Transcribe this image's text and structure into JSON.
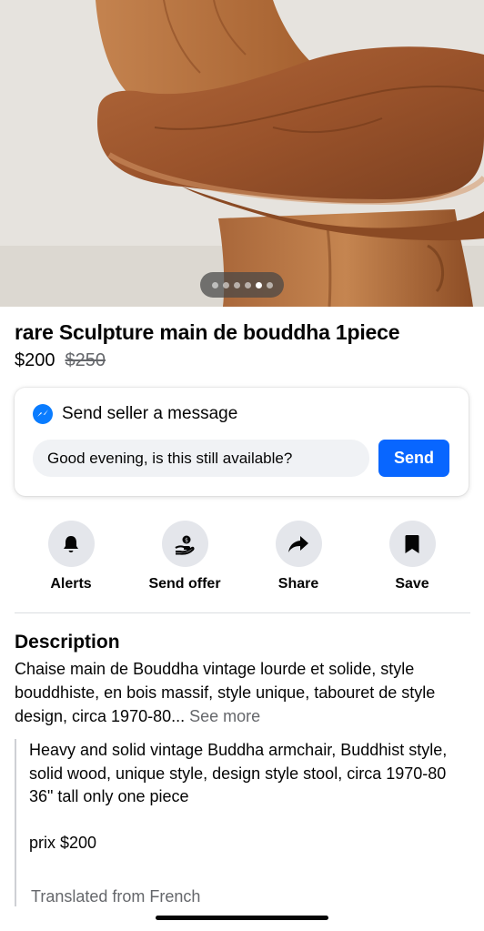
{
  "gallery": {
    "photo_count": 6,
    "active_index": 4
  },
  "listing": {
    "title": "rare Sculpture main de bouddha 1piece",
    "price": "$200",
    "original_price": "$250"
  },
  "message_card": {
    "heading": "Send seller a message",
    "input_value": "Good evening, is this still available?",
    "send_label": "Send"
  },
  "actions": [
    {
      "label": "Alerts",
      "icon": "bell-icon"
    },
    {
      "label": "Send offer",
      "icon": "offer-icon"
    },
    {
      "label": "Share",
      "icon": "share-icon"
    },
    {
      "label": "Save",
      "icon": "bookmark-icon"
    }
  ],
  "description": {
    "heading": "Description",
    "body": "Chaise main  de Bouddha vintage lourde et solide, style bouddhiste, en bois massif, style unique, tabouret de style design, circa 1970-80...",
    "see_more": "See more",
    "translation": "Heavy and solid vintage Buddha armchair, Buddhist style, solid wood, unique style, design style stool, circa 1970-80\n36\" tall only one piece\n\nprix $200",
    "translation_note": "Translated from French"
  },
  "colors": {
    "accent": "#0866ff",
    "messenger": "#0a7cff",
    "muted": "#65676b",
    "icon_bg": "#e4e6eb"
  }
}
